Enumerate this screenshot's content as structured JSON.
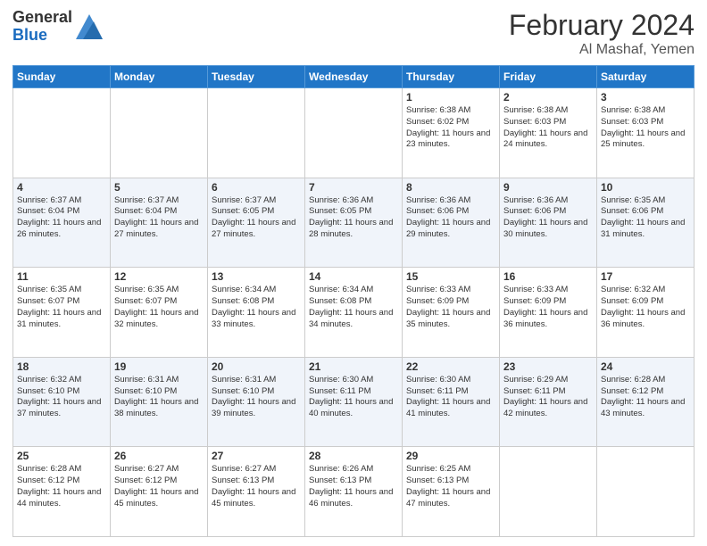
{
  "logo": {
    "general": "General",
    "blue": "Blue"
  },
  "header": {
    "month": "February 2024",
    "location": "Al Mashaf, Yemen"
  },
  "weekdays": [
    "Sunday",
    "Monday",
    "Tuesday",
    "Wednesday",
    "Thursday",
    "Friday",
    "Saturday"
  ],
  "weeks": [
    [
      {
        "day": "",
        "info": ""
      },
      {
        "day": "",
        "info": ""
      },
      {
        "day": "",
        "info": ""
      },
      {
        "day": "",
        "info": ""
      },
      {
        "day": "1",
        "info": "Sunrise: 6:38 AM\nSunset: 6:02 PM\nDaylight: 11 hours and 23 minutes."
      },
      {
        "day": "2",
        "info": "Sunrise: 6:38 AM\nSunset: 6:03 PM\nDaylight: 11 hours and 24 minutes."
      },
      {
        "day": "3",
        "info": "Sunrise: 6:38 AM\nSunset: 6:03 PM\nDaylight: 11 hours and 25 minutes."
      }
    ],
    [
      {
        "day": "4",
        "info": "Sunrise: 6:37 AM\nSunset: 6:04 PM\nDaylight: 11 hours and 26 minutes."
      },
      {
        "day": "5",
        "info": "Sunrise: 6:37 AM\nSunset: 6:04 PM\nDaylight: 11 hours and 27 minutes."
      },
      {
        "day": "6",
        "info": "Sunrise: 6:37 AM\nSunset: 6:05 PM\nDaylight: 11 hours and 27 minutes."
      },
      {
        "day": "7",
        "info": "Sunrise: 6:36 AM\nSunset: 6:05 PM\nDaylight: 11 hours and 28 minutes."
      },
      {
        "day": "8",
        "info": "Sunrise: 6:36 AM\nSunset: 6:06 PM\nDaylight: 11 hours and 29 minutes."
      },
      {
        "day": "9",
        "info": "Sunrise: 6:36 AM\nSunset: 6:06 PM\nDaylight: 11 hours and 30 minutes."
      },
      {
        "day": "10",
        "info": "Sunrise: 6:35 AM\nSunset: 6:06 PM\nDaylight: 11 hours and 31 minutes."
      }
    ],
    [
      {
        "day": "11",
        "info": "Sunrise: 6:35 AM\nSunset: 6:07 PM\nDaylight: 11 hours and 31 minutes."
      },
      {
        "day": "12",
        "info": "Sunrise: 6:35 AM\nSunset: 6:07 PM\nDaylight: 11 hours and 32 minutes."
      },
      {
        "day": "13",
        "info": "Sunrise: 6:34 AM\nSunset: 6:08 PM\nDaylight: 11 hours and 33 minutes."
      },
      {
        "day": "14",
        "info": "Sunrise: 6:34 AM\nSunset: 6:08 PM\nDaylight: 11 hours and 34 minutes."
      },
      {
        "day": "15",
        "info": "Sunrise: 6:33 AM\nSunset: 6:09 PM\nDaylight: 11 hours and 35 minutes."
      },
      {
        "day": "16",
        "info": "Sunrise: 6:33 AM\nSunset: 6:09 PM\nDaylight: 11 hours and 36 minutes."
      },
      {
        "day": "17",
        "info": "Sunrise: 6:32 AM\nSunset: 6:09 PM\nDaylight: 11 hours and 36 minutes."
      }
    ],
    [
      {
        "day": "18",
        "info": "Sunrise: 6:32 AM\nSunset: 6:10 PM\nDaylight: 11 hours and 37 minutes."
      },
      {
        "day": "19",
        "info": "Sunrise: 6:31 AM\nSunset: 6:10 PM\nDaylight: 11 hours and 38 minutes."
      },
      {
        "day": "20",
        "info": "Sunrise: 6:31 AM\nSunset: 6:10 PM\nDaylight: 11 hours and 39 minutes."
      },
      {
        "day": "21",
        "info": "Sunrise: 6:30 AM\nSunset: 6:11 PM\nDaylight: 11 hours and 40 minutes."
      },
      {
        "day": "22",
        "info": "Sunrise: 6:30 AM\nSunset: 6:11 PM\nDaylight: 11 hours and 41 minutes."
      },
      {
        "day": "23",
        "info": "Sunrise: 6:29 AM\nSunset: 6:11 PM\nDaylight: 11 hours and 42 minutes."
      },
      {
        "day": "24",
        "info": "Sunrise: 6:28 AM\nSunset: 6:12 PM\nDaylight: 11 hours and 43 minutes."
      }
    ],
    [
      {
        "day": "25",
        "info": "Sunrise: 6:28 AM\nSunset: 6:12 PM\nDaylight: 11 hours and 44 minutes."
      },
      {
        "day": "26",
        "info": "Sunrise: 6:27 AM\nSunset: 6:12 PM\nDaylight: 11 hours and 45 minutes."
      },
      {
        "day": "27",
        "info": "Sunrise: 6:27 AM\nSunset: 6:13 PM\nDaylight: 11 hours and 45 minutes."
      },
      {
        "day": "28",
        "info": "Sunrise: 6:26 AM\nSunset: 6:13 PM\nDaylight: 11 hours and 46 minutes."
      },
      {
        "day": "29",
        "info": "Sunrise: 6:25 AM\nSunset: 6:13 PM\nDaylight: 11 hours and 47 minutes."
      },
      {
        "day": "",
        "info": ""
      },
      {
        "day": "",
        "info": ""
      }
    ]
  ]
}
